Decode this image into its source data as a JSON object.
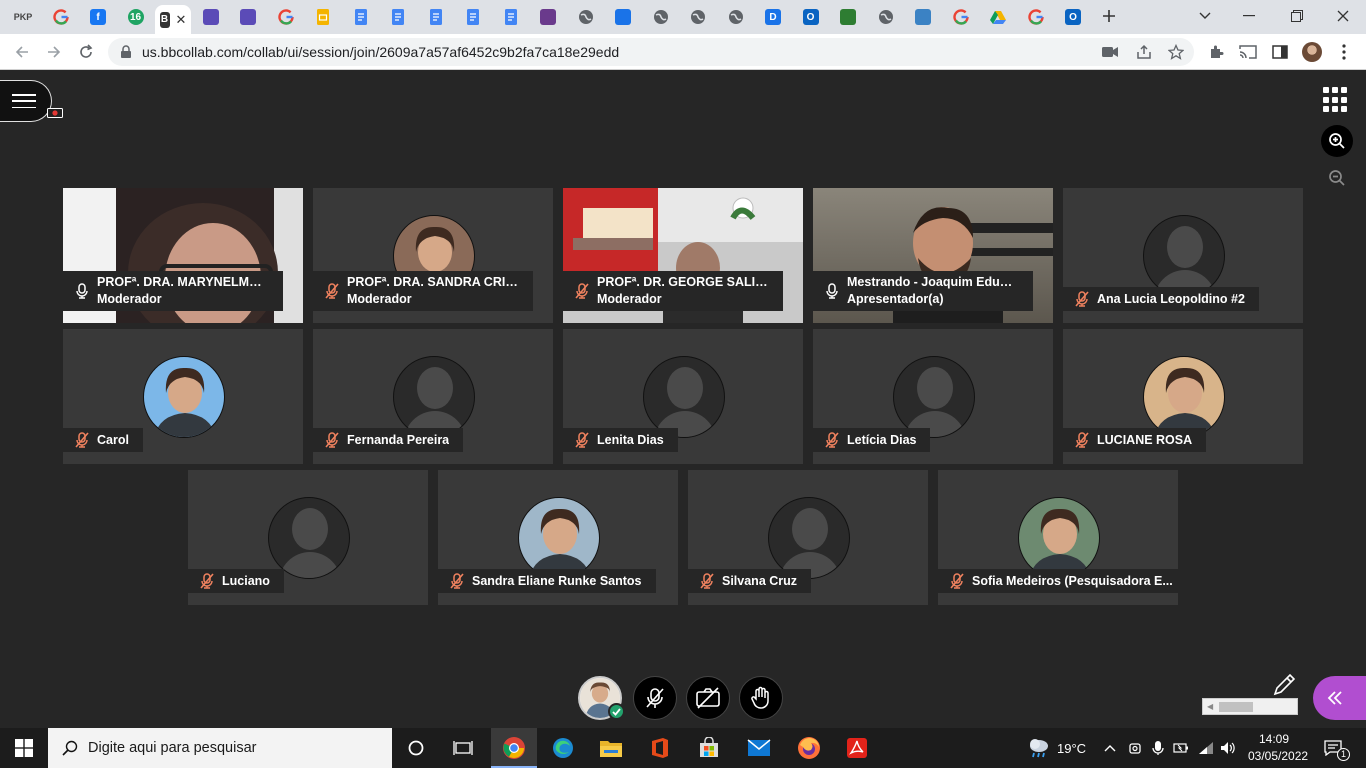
{
  "browser": {
    "url": "us.bbcollab.com/collab/ui/session/join/2609a7a57af6452c9b2fa7ca18e29edd",
    "tabs": [
      {
        "icon": "pkp-icon",
        "letter": "PKP",
        "color": "#444444"
      },
      {
        "icon": "google-icon",
        "letter": "G",
        "color": "#4285f4"
      },
      {
        "icon": "facebook-icon",
        "letter": "f",
        "color": "#1877f2"
      },
      {
        "icon": "counter-icon",
        "letter": "16",
        "color": "#1fa463"
      },
      {
        "icon": "collab-icon",
        "letter": "B",
        "color": "#333333",
        "active": true
      },
      {
        "icon": "purple-square-icon",
        "letter": "",
        "color": "#5b4bb7"
      },
      {
        "icon": "purple-square-icon",
        "letter": "",
        "color": "#5b4bb7"
      },
      {
        "icon": "google-icon",
        "letter": "G",
        "color": "#4285f4"
      },
      {
        "icon": "slides-icon",
        "letter": "",
        "color": "#f4b400"
      },
      {
        "icon": "docs-icon",
        "letter": "",
        "color": "#4285f4"
      },
      {
        "icon": "docs-icon",
        "letter": "",
        "color": "#4285f4"
      },
      {
        "icon": "docs-icon",
        "letter": "",
        "color": "#4285f4"
      },
      {
        "icon": "docs-icon",
        "letter": "",
        "color": "#4285f4"
      },
      {
        "icon": "docs-icon",
        "letter": "",
        "color": "#4285f4"
      },
      {
        "icon": "drop-icon",
        "letter": "",
        "color": "#6a3a8c"
      },
      {
        "icon": "globe-icon",
        "letter": "",
        "color": "#5f6368"
      },
      {
        "icon": "inbox-icon",
        "letter": "",
        "color": "#1a73e8"
      },
      {
        "icon": "globe-icon",
        "letter": "",
        "color": "#5f6368"
      },
      {
        "icon": "globe-icon",
        "letter": "",
        "color": "#5f6368"
      },
      {
        "icon": "globe-icon",
        "letter": "",
        "color": "#5f6368"
      },
      {
        "icon": "d-icon",
        "letter": "D",
        "color": "#1a73e8"
      },
      {
        "icon": "outlook-icon",
        "letter": "O",
        "color": "#0a64c2"
      },
      {
        "icon": "tree-icon",
        "letter": "",
        "color": "#2e7d32"
      },
      {
        "icon": "globe-icon",
        "letter": "",
        "color": "#5f6368"
      },
      {
        "icon": "earth-icon",
        "letter": "",
        "color": "#3b82c4"
      },
      {
        "icon": "google-icon",
        "letter": "G",
        "color": "#4285f4"
      },
      {
        "icon": "drive-icon",
        "letter": "",
        "color": "#0f9d58"
      },
      {
        "icon": "google-icon",
        "letter": "G",
        "color": "#4285f4"
      },
      {
        "icon": "outlook-icon",
        "letter": "O",
        "color": "#0a64c2"
      }
    ]
  },
  "participants": [
    {
      "name": "PROFª. DRA. MARYNELMA CAM...",
      "role": "Moderador",
      "mic": "on",
      "media": "video",
      "tone": "#3a3030"
    },
    {
      "name": "PROFª. DRA. SANDRA CRISTINA ...",
      "role": "Moderador",
      "mic": "off",
      "media": "photo",
      "tone": "#8a6a58"
    },
    {
      "name": "PROFª. DR. GEORGE SALIBA MA...",
      "role": "Moderador",
      "mic": "off",
      "media": "video",
      "tone": "#cfcfcf"
    },
    {
      "name": "Mestrando - Joaquim Eduardo ...",
      "role": "Apresentador(a)",
      "mic": "on",
      "media": "video",
      "tone": "#6f6a60"
    },
    {
      "name": "Ana Lucia Leopoldino #2",
      "role": "",
      "mic": "off",
      "media": "default"
    },
    {
      "name": "Carol",
      "role": "",
      "mic": "off",
      "media": "photo",
      "tone": "#7cb7e8"
    },
    {
      "name": "Fernanda Pereira",
      "role": "",
      "mic": "off",
      "media": "default"
    },
    {
      "name": "Lenita Dias",
      "role": "",
      "mic": "off",
      "media": "default"
    },
    {
      "name": "Letícia Dias",
      "role": "",
      "mic": "off",
      "media": "default"
    },
    {
      "name": "LUCIANE ROSA",
      "role": "",
      "mic": "off",
      "media": "photo",
      "tone": "#d8b48a"
    },
    {
      "name": "Luciano",
      "role": "",
      "mic": "off",
      "media": "default"
    },
    {
      "name": "Sandra Eliane Runke Santos",
      "role": "",
      "mic": "off",
      "media": "photo",
      "tone": "#9fb7c9"
    },
    {
      "name": "Silvana Cruz",
      "role": "",
      "mic": "off",
      "media": "default"
    },
    {
      "name": "Sofia Medeiros (Pesquisadora E...",
      "role": "",
      "mic": "off",
      "media": "photo",
      "tone": "#6d8a70"
    }
  ],
  "taskbar": {
    "search_placeholder": "Digite aqui para pesquisar",
    "temperature": "19°C",
    "time": "14:09",
    "date": "03/05/2022",
    "notifications": "1"
  },
  "colors": {
    "accent_panel": "#b14ed0",
    "active_speaker_border": "#f1a592",
    "status_available": "#23a26d"
  }
}
